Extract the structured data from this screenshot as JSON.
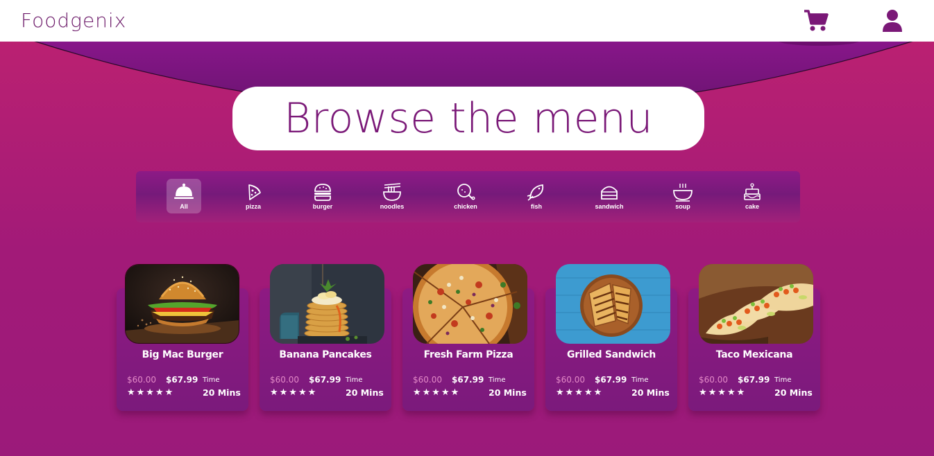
{
  "header": {
    "logo": "Foodgenix",
    "cart_icon": "cart-icon",
    "user_icon": "user-icon"
  },
  "hero": {
    "title": "Browse the menu"
  },
  "categories": [
    {
      "label": "All",
      "icon": "cloche-icon",
      "active": true
    },
    {
      "label": "pizza",
      "icon": "pizza-icon",
      "active": false
    },
    {
      "label": "burger",
      "icon": "burger-icon",
      "active": false
    },
    {
      "label": "noodles",
      "icon": "noodles-icon",
      "active": false
    },
    {
      "label": "chicken",
      "icon": "chicken-icon",
      "active": false
    },
    {
      "label": "fish",
      "icon": "fish-icon",
      "active": false
    },
    {
      "label": "sandwich",
      "icon": "sandwich-icon",
      "active": false
    },
    {
      "label": "soup",
      "icon": "soup-icon",
      "active": false
    },
    {
      "label": "cake",
      "icon": "cake-icon",
      "active": false
    }
  ],
  "products": [
    {
      "name": "Big Mac Burger",
      "old_price": "$60.00",
      "price": "$67.99",
      "time_label": "Time",
      "time": "20 Mins",
      "rating": 5,
      "stars": "★★★★★"
    },
    {
      "name": "Banana Pancakes",
      "old_price": "$60.00",
      "price": "$67.99",
      "time_label": "Time",
      "time": "20 Mins",
      "rating": 5,
      "stars": "★★★★★"
    },
    {
      "name": "Fresh Farm Pizza",
      "old_price": "$60.00",
      "price": "$67.99",
      "time_label": "Time",
      "time": "20 Mins",
      "rating": 5,
      "stars": "★★★★★"
    },
    {
      "name": "Grilled Sandwich",
      "old_price": "$60.00",
      "price": "$67.99",
      "time_label": "Time",
      "time": "20 Mins",
      "rating": 5,
      "stars": "★★★★★"
    },
    {
      "name": "Taco Mexicana",
      "old_price": "$60.00",
      "price": "$67.99",
      "time_label": "Time",
      "time": "20 Mins",
      "rating": 5,
      "stars": "★★★★★"
    }
  ],
  "colors": {
    "brand": "#7a1877",
    "background_top": "#bf2270",
    "background_bottom": "#9b1a7a",
    "old_price": "#e48bc8"
  }
}
